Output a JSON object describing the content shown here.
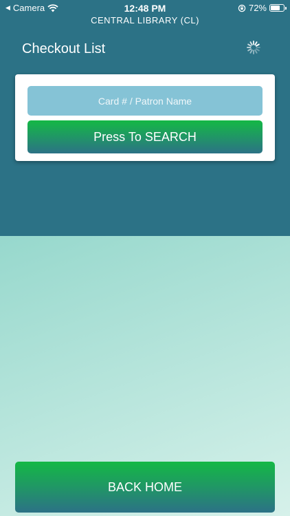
{
  "status_bar": {
    "back_app": "Camera",
    "time": "12:48 PM",
    "battery": "72%",
    "battery_level": 0.72
  },
  "header": {
    "location": "CENTRAL LIBRARY (CL)",
    "title": "Checkout List"
  },
  "search": {
    "placeholder": "Card # / Patron Name",
    "button_label": "Press To SEARCH"
  },
  "footer": {
    "back_home_label": "BACK HOME"
  },
  "colors": {
    "header_bg": "#2c7286",
    "input_bg": "#85c3d6",
    "button_green": "#14b845"
  },
  "icons": [
    "back-arrow-icon",
    "wifi-icon",
    "orientation-lock-icon",
    "battery-icon",
    "loading-spinner-icon"
  ]
}
